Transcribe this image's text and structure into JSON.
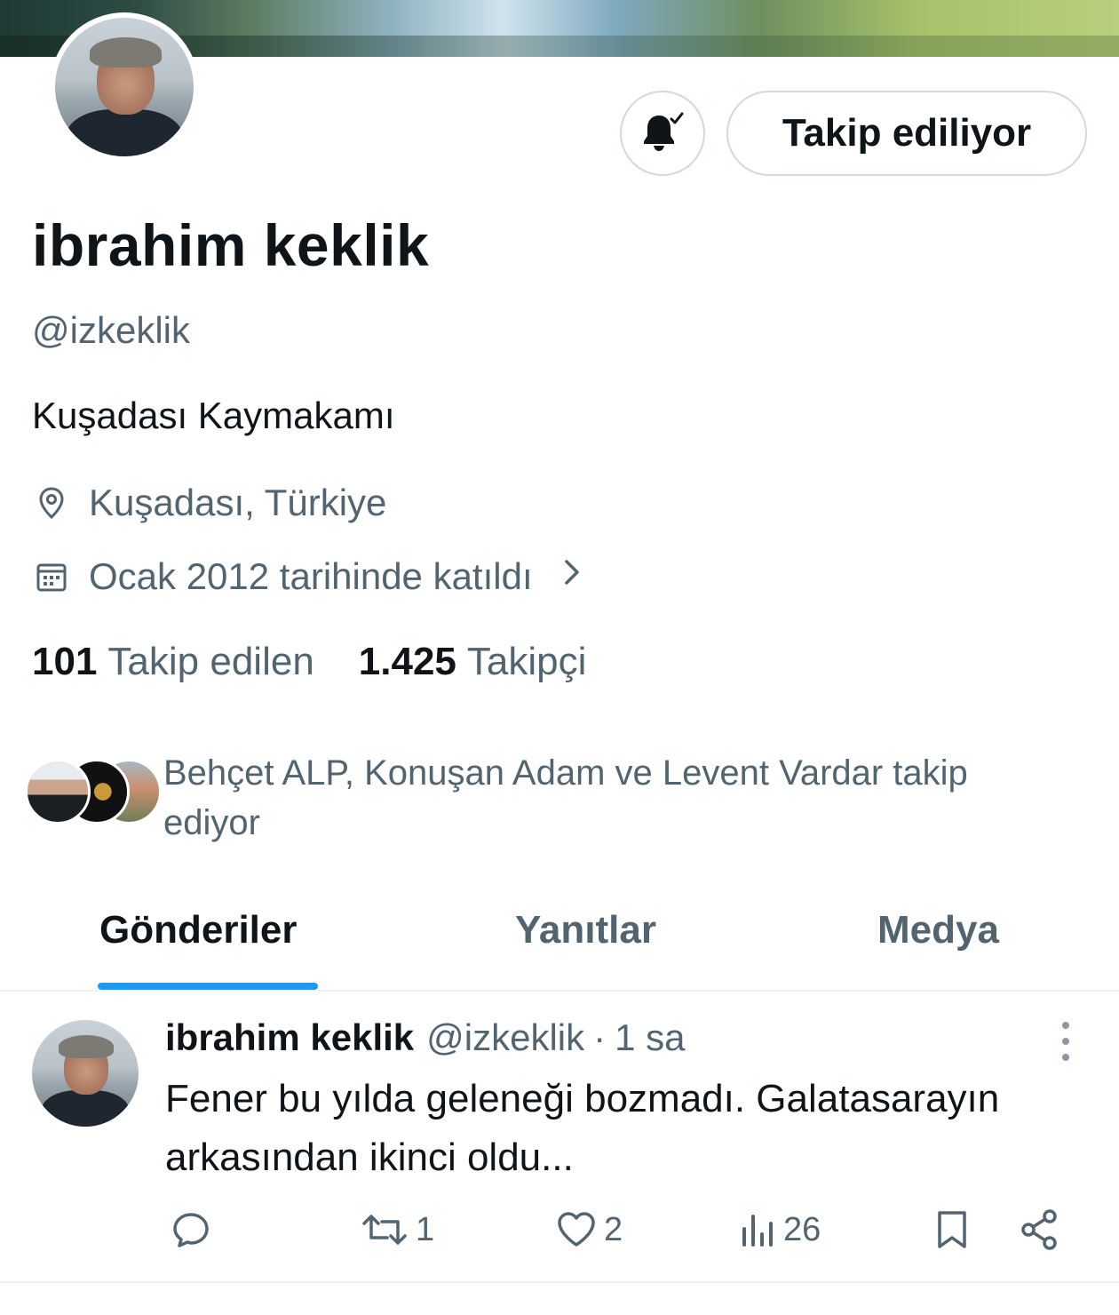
{
  "profile": {
    "name": "ibrahim keklik",
    "handle": "@izkeklik",
    "bio": "Kuşadası Kaymakamı",
    "location": "Kuşadası, Türkiye",
    "joined": "Ocak 2012 tarihinde katıldı",
    "following_count": "101",
    "following_label": "Takip edilen",
    "followers_count": "1.425",
    "followers_label": "Takipçi",
    "followed_by_text": "Behçet ALP, Konuşan Adam ve Levent Vardar takip ediyor"
  },
  "buttons": {
    "follow_label": "Takip ediliyor",
    "notification_icon": "bell-check-icon"
  },
  "tabs": [
    {
      "label": "Gönderiler",
      "active": true
    },
    {
      "label": "Yanıtlar",
      "active": false
    },
    {
      "label": "Medya",
      "active": false
    }
  ],
  "tweet": {
    "author": "ibrahim keklik",
    "handle": "@izkeklik",
    "separator": "·",
    "time": "1 sa",
    "text": "Fener bu yılda geleneği bozmadı. Galatasarayın arkasından ikinci oldu...",
    "retweets": "1",
    "likes": "2",
    "views": "26"
  },
  "colors": {
    "accent": "#1d9bf0",
    "text_primary": "#0f1419",
    "text_secondary": "#536471",
    "border": "#cfd9de"
  }
}
